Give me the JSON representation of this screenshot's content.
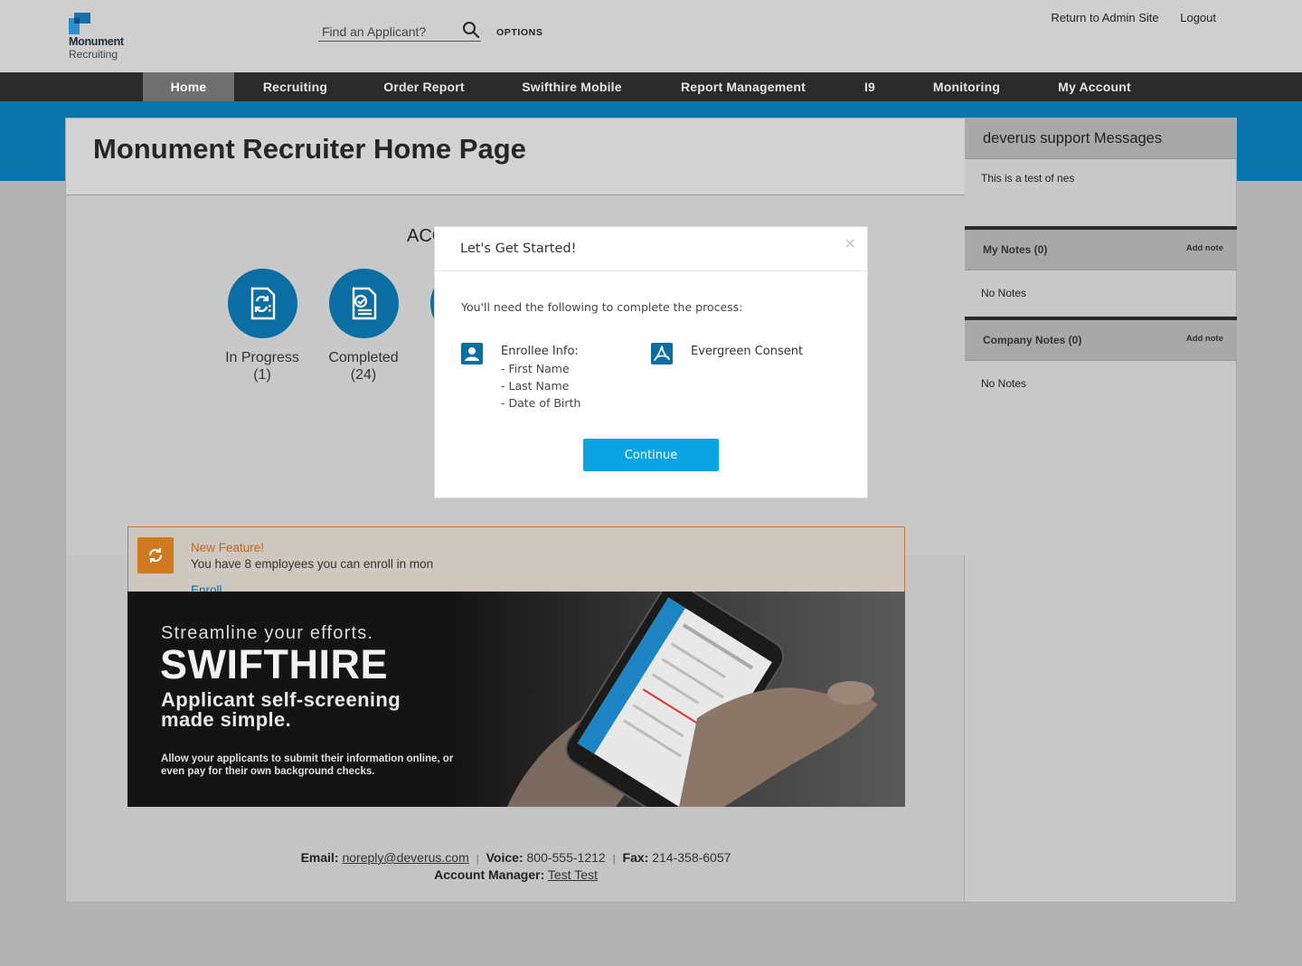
{
  "header": {
    "logo_line1": "Monument",
    "logo_line2": "Recruiting",
    "search_placeholder": "Find an Applicant?",
    "options_label": "OPTIONS",
    "return_link": "Return to Admin Site",
    "logout_link": "Logout"
  },
  "nav": {
    "items": [
      {
        "label": "Home",
        "active": true
      },
      {
        "label": "Recruiting"
      },
      {
        "label": "Order Report"
      },
      {
        "label": "Swifthire Mobile"
      },
      {
        "label": "Report Management"
      },
      {
        "label": "I9"
      },
      {
        "label": "Monitoring"
      },
      {
        "label": "My Account"
      }
    ]
  },
  "main": {
    "page_title": "Monument Recruiter Home Page",
    "section_title": "ACC",
    "stats": [
      {
        "label": "In Progress",
        "count": "(1)"
      },
      {
        "label": "Completed",
        "count": "(24)"
      }
    ],
    "feature": {
      "title": "New Feature!",
      "text": "You have 8 employees you can enroll in mon",
      "link": "Enroll"
    },
    "banner": {
      "subtitle": "Streamline your efforts.",
      "title": "SWIFTHIRE",
      "tagline": "Applicant self-screening made simple.",
      "small": "Allow your applicants to submit their information online, or even pay for their own background checks."
    },
    "footer": {
      "email_label": "Email:",
      "email": "noreply@deverus.com",
      "voice_label": "Voice:",
      "voice": "800-555-1212",
      "fax_label": "Fax:",
      "fax": "214-358-6057",
      "manager_label": "Account Manager:",
      "manager": "Test Test"
    }
  },
  "sidebar": {
    "messages_title": "deverus support Messages",
    "message": "This is a test of nes",
    "my_notes_title": "My Notes (0)",
    "company_notes_title": "Company Notes (0)",
    "add_note": "Add note",
    "no_notes": "No Notes"
  },
  "modal": {
    "title": "Let's Get Started!",
    "close": "×",
    "intro": "You'll need the following to complete the process:",
    "enrollee_title": "Enrollee Info:",
    "enrollee_items": [
      "- First Name",
      "- Last Name",
      "- Date of Birth"
    ],
    "consent_title": "Evergreen Consent",
    "continue_label": "Continue"
  },
  "colors": {
    "accent_blue": "#0a6ea3",
    "button_blue": "#0aa4e4",
    "band_blue": "#0a74ad",
    "feature_orange": "#d07a20",
    "nav_dark": "#2b2b2b"
  }
}
